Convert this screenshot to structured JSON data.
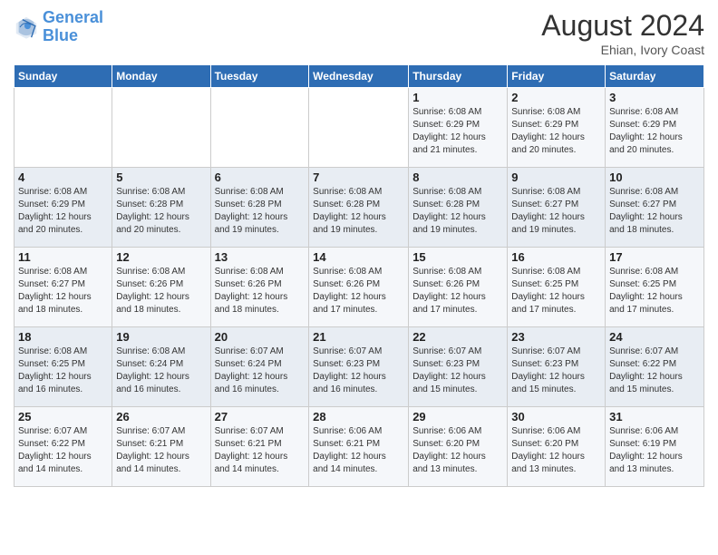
{
  "logo": {
    "line1": "General",
    "line2": "Blue"
  },
  "title": "August 2024",
  "location": "Ehian, Ivory Coast",
  "days_of_week": [
    "Sunday",
    "Monday",
    "Tuesday",
    "Wednesday",
    "Thursday",
    "Friday",
    "Saturday"
  ],
  "weeks": [
    [
      {
        "day": "",
        "info": ""
      },
      {
        "day": "",
        "info": ""
      },
      {
        "day": "",
        "info": ""
      },
      {
        "day": "",
        "info": ""
      },
      {
        "day": "1",
        "info": "Sunrise: 6:08 AM\nSunset: 6:29 PM\nDaylight: 12 hours\nand 21 minutes."
      },
      {
        "day": "2",
        "info": "Sunrise: 6:08 AM\nSunset: 6:29 PM\nDaylight: 12 hours\nand 20 minutes."
      },
      {
        "day": "3",
        "info": "Sunrise: 6:08 AM\nSunset: 6:29 PM\nDaylight: 12 hours\nand 20 minutes."
      }
    ],
    [
      {
        "day": "4",
        "info": "Sunrise: 6:08 AM\nSunset: 6:29 PM\nDaylight: 12 hours\nand 20 minutes."
      },
      {
        "day": "5",
        "info": "Sunrise: 6:08 AM\nSunset: 6:28 PM\nDaylight: 12 hours\nand 20 minutes."
      },
      {
        "day": "6",
        "info": "Sunrise: 6:08 AM\nSunset: 6:28 PM\nDaylight: 12 hours\nand 19 minutes."
      },
      {
        "day": "7",
        "info": "Sunrise: 6:08 AM\nSunset: 6:28 PM\nDaylight: 12 hours\nand 19 minutes."
      },
      {
        "day": "8",
        "info": "Sunrise: 6:08 AM\nSunset: 6:28 PM\nDaylight: 12 hours\nand 19 minutes."
      },
      {
        "day": "9",
        "info": "Sunrise: 6:08 AM\nSunset: 6:27 PM\nDaylight: 12 hours\nand 19 minutes."
      },
      {
        "day": "10",
        "info": "Sunrise: 6:08 AM\nSunset: 6:27 PM\nDaylight: 12 hours\nand 18 minutes."
      }
    ],
    [
      {
        "day": "11",
        "info": "Sunrise: 6:08 AM\nSunset: 6:27 PM\nDaylight: 12 hours\nand 18 minutes."
      },
      {
        "day": "12",
        "info": "Sunrise: 6:08 AM\nSunset: 6:26 PM\nDaylight: 12 hours\nand 18 minutes."
      },
      {
        "day": "13",
        "info": "Sunrise: 6:08 AM\nSunset: 6:26 PM\nDaylight: 12 hours\nand 18 minutes."
      },
      {
        "day": "14",
        "info": "Sunrise: 6:08 AM\nSunset: 6:26 PM\nDaylight: 12 hours\nand 17 minutes."
      },
      {
        "day": "15",
        "info": "Sunrise: 6:08 AM\nSunset: 6:26 PM\nDaylight: 12 hours\nand 17 minutes."
      },
      {
        "day": "16",
        "info": "Sunrise: 6:08 AM\nSunset: 6:25 PM\nDaylight: 12 hours\nand 17 minutes."
      },
      {
        "day": "17",
        "info": "Sunrise: 6:08 AM\nSunset: 6:25 PM\nDaylight: 12 hours\nand 17 minutes."
      }
    ],
    [
      {
        "day": "18",
        "info": "Sunrise: 6:08 AM\nSunset: 6:25 PM\nDaylight: 12 hours\nand 16 minutes."
      },
      {
        "day": "19",
        "info": "Sunrise: 6:08 AM\nSunset: 6:24 PM\nDaylight: 12 hours\nand 16 minutes."
      },
      {
        "day": "20",
        "info": "Sunrise: 6:07 AM\nSunset: 6:24 PM\nDaylight: 12 hours\nand 16 minutes."
      },
      {
        "day": "21",
        "info": "Sunrise: 6:07 AM\nSunset: 6:23 PM\nDaylight: 12 hours\nand 16 minutes."
      },
      {
        "day": "22",
        "info": "Sunrise: 6:07 AM\nSunset: 6:23 PM\nDaylight: 12 hours\nand 15 minutes."
      },
      {
        "day": "23",
        "info": "Sunrise: 6:07 AM\nSunset: 6:23 PM\nDaylight: 12 hours\nand 15 minutes."
      },
      {
        "day": "24",
        "info": "Sunrise: 6:07 AM\nSunset: 6:22 PM\nDaylight: 12 hours\nand 15 minutes."
      }
    ],
    [
      {
        "day": "25",
        "info": "Sunrise: 6:07 AM\nSunset: 6:22 PM\nDaylight: 12 hours\nand 14 minutes."
      },
      {
        "day": "26",
        "info": "Sunrise: 6:07 AM\nSunset: 6:21 PM\nDaylight: 12 hours\nand 14 minutes."
      },
      {
        "day": "27",
        "info": "Sunrise: 6:07 AM\nSunset: 6:21 PM\nDaylight: 12 hours\nand 14 minutes."
      },
      {
        "day": "28",
        "info": "Sunrise: 6:06 AM\nSunset: 6:21 PM\nDaylight: 12 hours\nand 14 minutes."
      },
      {
        "day": "29",
        "info": "Sunrise: 6:06 AM\nSunset: 6:20 PM\nDaylight: 12 hours\nand 13 minutes."
      },
      {
        "day": "30",
        "info": "Sunrise: 6:06 AM\nSunset: 6:20 PM\nDaylight: 12 hours\nand 13 minutes."
      },
      {
        "day": "31",
        "info": "Sunrise: 6:06 AM\nSunset: 6:19 PM\nDaylight: 12 hours\nand 13 minutes."
      }
    ]
  ]
}
